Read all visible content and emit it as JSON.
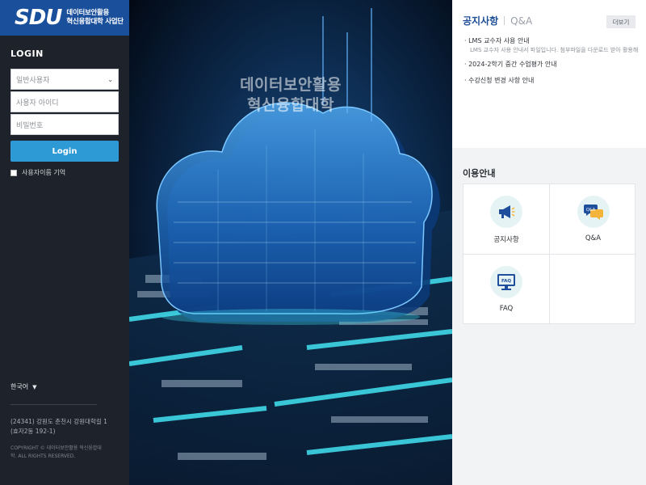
{
  "brand": {
    "logo_mark": "SDU",
    "logo_line1": "데이터보안활용",
    "logo_line2": "혁신융합대학 사업단"
  },
  "login": {
    "title": "LOGIN",
    "user_type_selected": "일반사용자",
    "id_placeholder": "사용자 아이디",
    "pw_placeholder": "비밀번호",
    "button": "Login",
    "remember_label": "사용자이름 기억"
  },
  "footer": {
    "language": "한국어",
    "address": "(24341) 강원도 춘천시 강원대학길 1 (효자2동 192-1)",
    "copyright": "COPYRIGHT © 데이터보안활용 혁신융합대학. ALL RIGHTS RESERVED."
  },
  "hero": {
    "line1": "데이터보안활용",
    "line2": "혁신융합대학"
  },
  "notice": {
    "tab_active": "공지사항",
    "tab_other": "Q&A",
    "more": "더보기",
    "items": [
      {
        "title": "· LMS 교수자 사용 안내",
        "sub": "LMS 교수자 사용 안내서 파일입니다. 첨부파일을 다운로드 받아 활용해"
      },
      {
        "title": "· 2024-2학기 중간 수업평가 안내"
      },
      {
        "title": "· 수강신청 변경 사항 안내"
      }
    ]
  },
  "info": {
    "title": "이용안내",
    "items": [
      {
        "label": "공지사항",
        "icon": "megaphone-icon"
      },
      {
        "label": "Q&A",
        "icon": "qa-chat-icon",
        "badge": "Q&A"
      },
      {
        "label": "FAQ",
        "icon": "faq-monitor-icon",
        "badge": "FAQ"
      }
    ]
  },
  "colors": {
    "brand_blue": "#1a4f9c",
    "login_button": "#2d9ad6",
    "sidebar_bg": "#1e232b",
    "tab_active": "#1d4e96"
  }
}
